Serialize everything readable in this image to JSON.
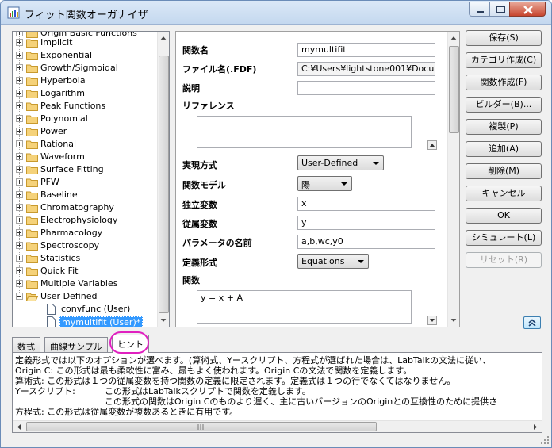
{
  "window": {
    "title": "フィット関数オーガナイザ"
  },
  "tree": {
    "partial_top": "Origin Basic Functions",
    "items": [
      "Implicit",
      "Exponential",
      "Growth/Sigmoidal",
      "Hyperbola",
      "Logarithm",
      "Peak Functions",
      "Polynomial",
      "Power",
      "Rational",
      "Waveform",
      "Surface Fitting",
      "PFW",
      "Baseline",
      "Chromatography",
      "Electrophysiology",
      "Pharmacology",
      "Spectroscopy",
      "Statistics",
      "Quick Fit",
      "Multiple Variables"
    ],
    "open_folder": "User Defined",
    "children": [
      "convfunc (User)",
      "mymultifit (User)*"
    ]
  },
  "props": {
    "func_name_label": "関数名",
    "func_name_value": "mymultifit",
    "file_name_label": "ファイル名(.FDF)",
    "file_name_value": "C:¥Users¥lightstone001¥Docu",
    "desc_label": "説明",
    "desc_value": "",
    "ref_label": "リファレンス",
    "ref_value": "",
    "impl_label": "実現方式",
    "impl_value": "User-Defined",
    "model_label": "関数モデル",
    "model_value": "陽",
    "indep_label": "独立変数",
    "indep_value": "x",
    "dep_label": "従属変数",
    "dep_value": "y",
    "params_label": "パラメータの名前",
    "params_value": "a,b,wc,y0",
    "form_label": "定義形式",
    "form_value": "Equations",
    "func_label": "関数",
    "func_value": "y = x + A"
  },
  "buttons": {
    "save": "保存(S)",
    "new_category": "カテゴリ作成(C)",
    "new_function": "関数作成(F)",
    "builder": "ビルダー(B)...",
    "duplicate": "複製(P)",
    "add": "追加(A)",
    "delete": "削除(M)",
    "cancel": "キャンセル",
    "ok": "OK",
    "simulate": "シミュレート(L)",
    "reset": "リセット(R)"
  },
  "tabs": {
    "formula": "数式",
    "sample_curve": "曲線サンプル",
    "hint": "ヒント"
  },
  "hint": {
    "lines": [
      "定義形式では以下のオプションが選べます。(算術式、Yースクリプト、方程式が選ばれた場合は、LabTalkの文法に従い、",
      "Origin C:  この形式は最も柔軟性に富み、最もよく使われます。Origin Cの文法で関数を定義します。",
      "算術式:  この形式は１つの従属変数を持つ関数の定義に限定されます。定義式は１つの行でなくてはなりません。",
      "Yースクリプト:",
      "この形式はLabTalkスクリプトで関数を定義します。",
      "この形式の関数はOrigin Cのものより遅く、主に古いバージョンのOriginとの互換性のために提供さ",
      "方程式:  この形式は従属変数が複数あるときに有用です。"
    ]
  },
  "colors": {
    "selection": "#3399ff",
    "highlight_ring": "#e020c0",
    "title_bar": "#c4d8ef"
  }
}
